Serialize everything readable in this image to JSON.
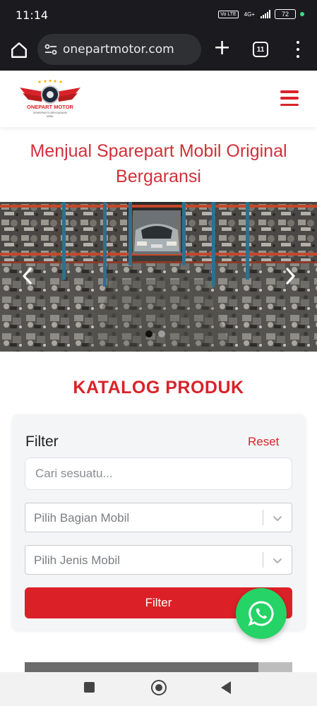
{
  "status_bar": {
    "time": "11:14",
    "network": "4G+",
    "volte": "Vo LTE",
    "battery": "72"
  },
  "browser": {
    "url": "onepartmotor.com",
    "tab_count": "11"
  },
  "site": {
    "logo": {
      "name": "ONEPART MOTOR",
      "tagline": "SPAREPARTS BERGARANSI",
      "sub": "MOBIL"
    },
    "hero_title": "Menjual Sparepart Mobil Original Bergaransi"
  },
  "carousel": {
    "slide_count": 2,
    "active_index": 0,
    "colors": {
      "active_dot": "#111111",
      "inactive_dot": "#9e9e9e"
    }
  },
  "catalog": {
    "title": "KATALOG PRODUK",
    "filter": {
      "heading": "Filter",
      "reset_label": "Reset",
      "search_placeholder": "Cari sesuatu...",
      "select_part": "Pilih Bagian Mobil",
      "select_type": "Pilih Jenis Mobil",
      "button_label": "Filter"
    }
  },
  "colors": {
    "brand_red": "#d8232a",
    "whatsapp_green": "#25d366"
  },
  "icons": [
    "home-icon",
    "tune-icon",
    "plus-icon",
    "tabs-icon",
    "more-vert-icon",
    "hamburger-icon",
    "chevron-left-icon",
    "chevron-right-icon",
    "chevron-down-icon",
    "whatsapp-icon"
  ]
}
